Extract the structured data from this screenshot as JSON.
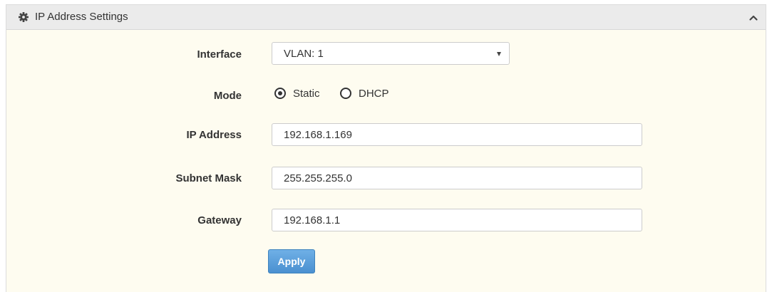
{
  "panel": {
    "title": "IP Address Settings",
    "header_icon": "gear-icon",
    "collapse_icon": "chevron-up-icon"
  },
  "form": {
    "interface": {
      "label": "Interface",
      "selected": "VLAN: 1"
    },
    "mode": {
      "label": "Mode",
      "options": [
        {
          "label": "Static",
          "checked": true
        },
        {
          "label": "DHCP",
          "checked": false
        }
      ]
    },
    "ip_address": {
      "label": "IP Address",
      "value": "192.168.1.169"
    },
    "subnet_mask": {
      "label": "Subnet Mask",
      "value": "255.255.255.0"
    },
    "gateway": {
      "label": "Gateway",
      "value": "192.168.1.1"
    },
    "apply_label": "Apply"
  },
  "colors": {
    "header_bg": "#ebebeb",
    "body_bg": "#fefcf0",
    "button_blue": "#4a90d0"
  }
}
